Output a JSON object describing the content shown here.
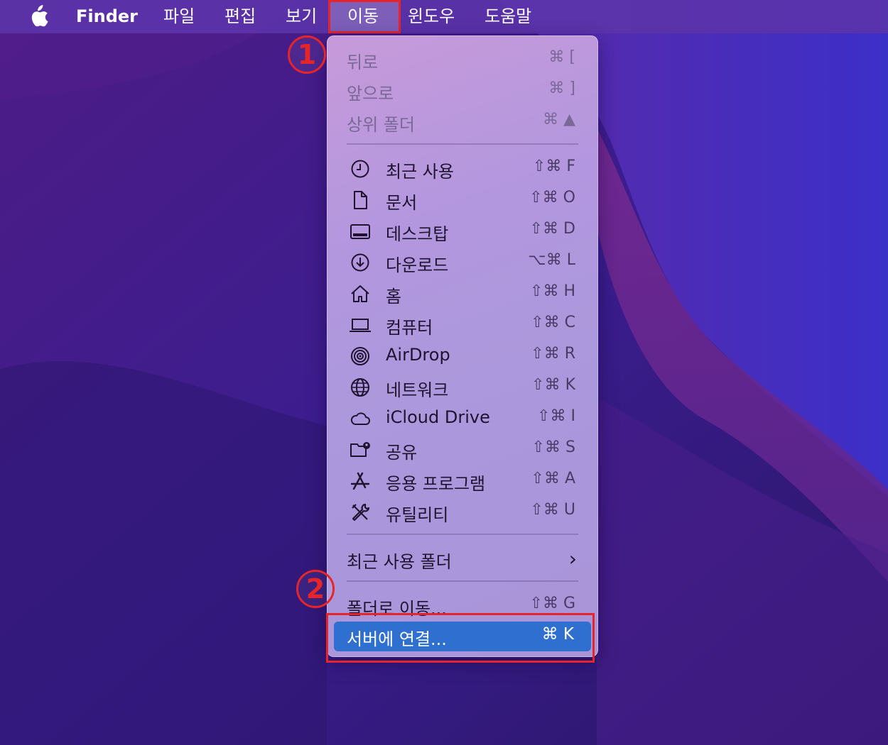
{
  "menubar": {
    "items": [
      "Finder",
      "파일",
      "편집",
      "보기",
      "이동",
      "윈도우",
      "도움말"
    ]
  },
  "menu": {
    "nav": [
      {
        "label": "뒤로",
        "shortcut": "⌘ ["
      },
      {
        "label": "앞으로",
        "shortcut": "⌘ ]"
      },
      {
        "label": "상위 폴더",
        "shortcut": "⌘ ▲"
      }
    ],
    "places": [
      {
        "label": "최근 사용",
        "shortcut": "⇧⌘ F",
        "icon": "clock-icon"
      },
      {
        "label": "문서",
        "shortcut": "⇧⌘ O",
        "icon": "document-icon"
      },
      {
        "label": "데스크탑",
        "shortcut": "⇧⌘ D",
        "icon": "desktop-icon"
      },
      {
        "label": "다운로드",
        "shortcut": "⌥⌘ L",
        "icon": "download-icon"
      },
      {
        "label": "홈",
        "shortcut": "⇧⌘ H",
        "icon": "home-icon"
      },
      {
        "label": "컴퓨터",
        "shortcut": "⇧⌘ C",
        "icon": "laptop-icon"
      },
      {
        "label": "AirDrop",
        "shortcut": "⇧⌘ R",
        "icon": "airdrop-icon"
      },
      {
        "label": "네트워크",
        "shortcut": "⇧⌘ K",
        "icon": "globe-icon"
      },
      {
        "label": "iCloud Drive",
        "shortcut": "⇧⌘ I",
        "icon": "cloud-icon"
      },
      {
        "label": "공유",
        "shortcut": "⇧⌘ S",
        "icon": "shared-folder-icon"
      },
      {
        "label": "응용 프로그램",
        "shortcut": "⇧⌘ A",
        "icon": "apps-icon"
      },
      {
        "label": "유틸리티",
        "shortcut": "⇧⌘ U",
        "icon": "utilities-icon"
      }
    ],
    "recent_folders": "최근 사용 폴더",
    "go_to_folder": {
      "label": "폴더로 이동...",
      "shortcut": "⇧⌘ G"
    },
    "connect_server": {
      "label": "서버에 연결...",
      "shortcut": "⌘ K"
    }
  },
  "annotations": {
    "step1": "1",
    "step2": "2"
  },
  "colors": {
    "highlight": "#e5252a",
    "selection": "#2f6fd0"
  }
}
